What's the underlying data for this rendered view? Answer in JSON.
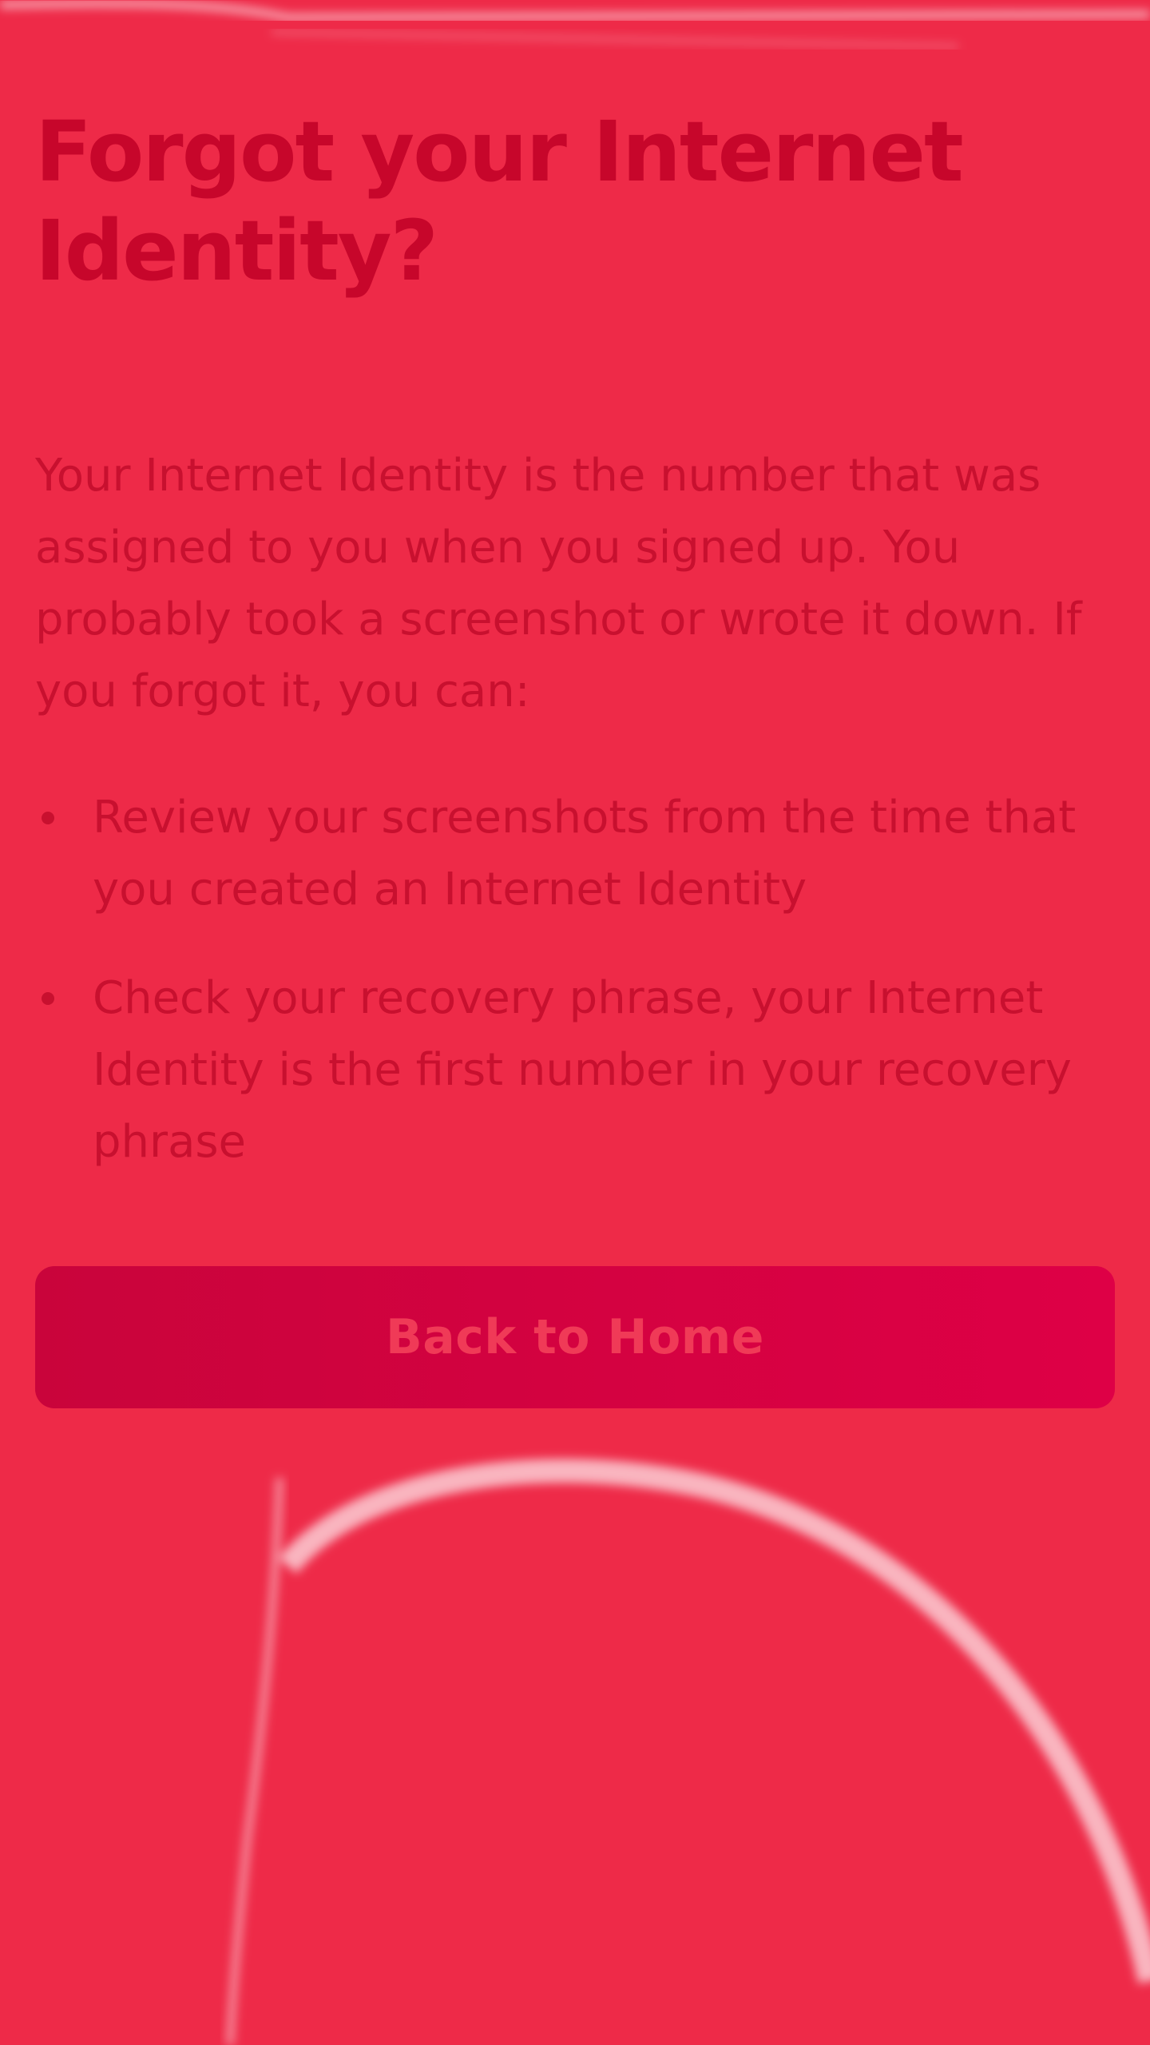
{
  "page": {
    "title": "Forgot your Internet Identity?",
    "intro": "Your Internet Identity is the number that was assigned to you when you signed up. You probably took a screenshot or wrote it down. If you forgot it, you can:",
    "bullets": [
      "Review your screenshots from the time that you created an Internet Identity",
      "Check your recovery phrase, your Internet Identity is the first number in your recovery phrase"
    ],
    "back_button_label": "Back to Home"
  },
  "colors": {
    "background": "#ee2a48",
    "text": "#c8102f",
    "button": "#d5003f",
    "button_text": "#f03a57"
  }
}
